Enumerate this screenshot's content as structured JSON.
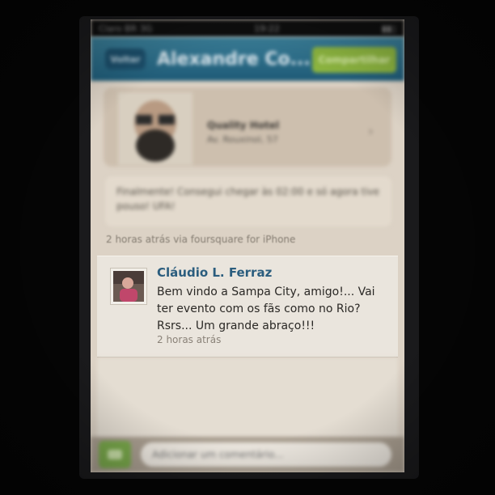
{
  "status_bar": {
    "carrier": "Claro BR",
    "network": "3G",
    "time": "19:22"
  },
  "nav": {
    "back_label": "Voltar",
    "title": "Alexandre Co...",
    "share_label": "Compartilhar"
  },
  "checkin": {
    "venue_name": "Quality Hotel",
    "venue_address": "Av. Rouxinol, 57",
    "shout": "Finalmente! Consegui chegar às 02:00 e só agora tive pouso! UFA!"
  },
  "meta": {
    "time": "2 horas atrás",
    "via": "via foursquare for iPhone"
  },
  "comment": {
    "author": "Cláudio L. Ferraz",
    "text": "Bem vindo a Sampa City, amigo!... Vai ter evento com os fãs como no Rio? Rsrs... Um grande abraço!!!",
    "time": "2 horas atrás"
  },
  "composer": {
    "placeholder": "Adicionar um comentário..."
  },
  "colors": {
    "nav": "#2a6b88",
    "accent_green": "#8bb33f",
    "author_blue": "#2b5d7e"
  },
  "icons": {
    "chevron": "chevron-right-icon",
    "camera": "camera-icon"
  }
}
